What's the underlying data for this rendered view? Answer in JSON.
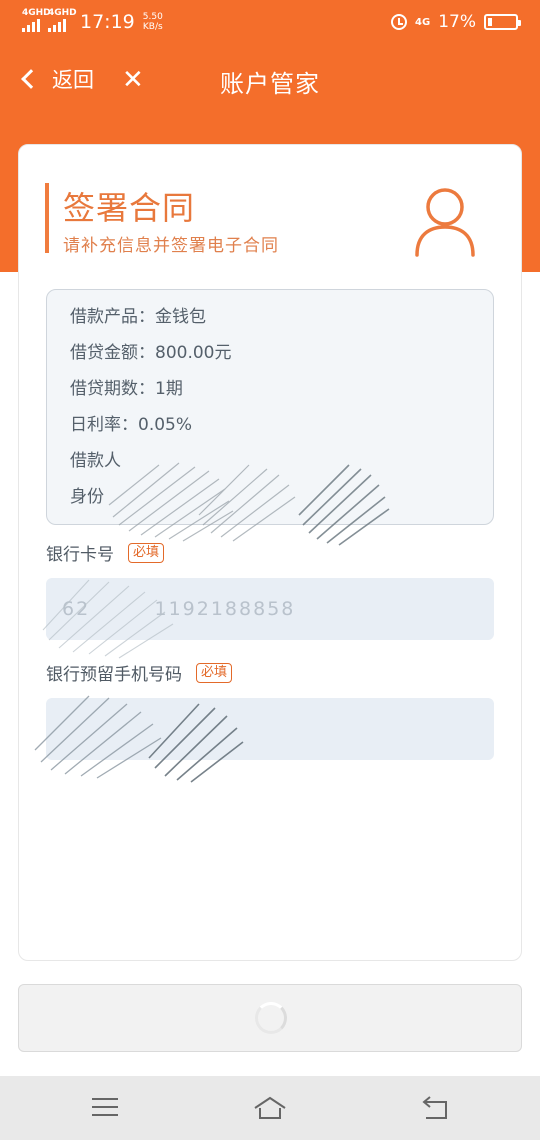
{
  "status_bar": {
    "sim1": "4GHD",
    "sim2": "4GHD",
    "time": "17:19",
    "net_speed_value": "5.50",
    "net_speed_unit": "KB/s",
    "net_small": "4G",
    "battery_percent": "17%",
    "battery_level": 0.17
  },
  "nav": {
    "back_label": "返回",
    "close_symbol": "✕",
    "title": "账户管家"
  },
  "card": {
    "title": "签署合同",
    "subtitle": "请补充信息并签署电子合同",
    "info": [
      {
        "label": "借款产品：",
        "value": "金钱包"
      },
      {
        "label": "借贷金额：",
        "value": "800.00元"
      },
      {
        "label": "借贷期数：",
        "value": "1期"
      },
      {
        "label": "日利率：",
        "value": "0.05%"
      },
      {
        "label": "借款人",
        "value": ""
      },
      {
        "label": "身份",
        "value": ""
      }
    ],
    "bank_card": {
      "label": "银行卡号",
      "required": "必填",
      "value": "62        1192188858"
    },
    "bank_phone": {
      "label": "银行预留手机号码",
      "required": "必填",
      "value": ""
    }
  },
  "colors": {
    "accent": "#f46e2b",
    "title_text": "#e8783c",
    "input_bg": "#e8eef5"
  },
  "icons": {
    "user": "user-outline-icon",
    "spinner": "loading-spinner-icon",
    "menu": "menu-icon",
    "home": "home-icon",
    "back": "back-icon"
  }
}
